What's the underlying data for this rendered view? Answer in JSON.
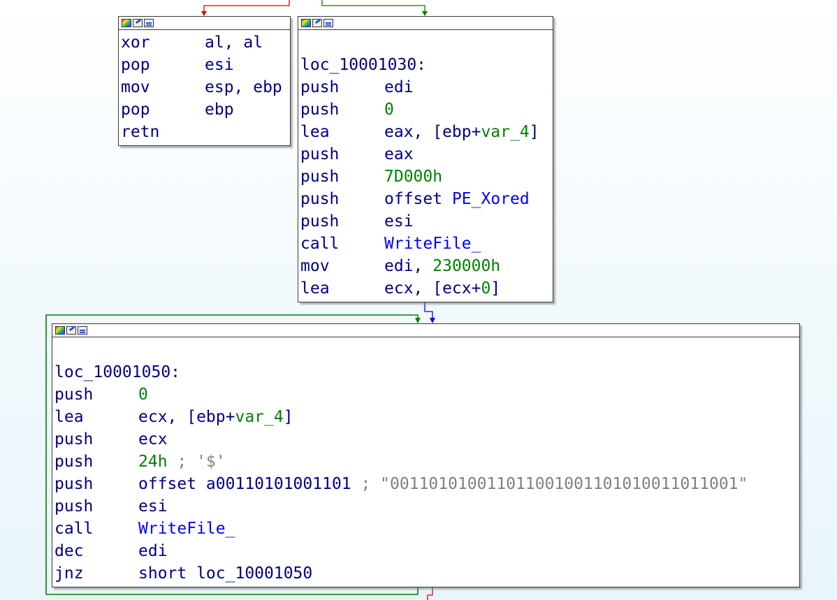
{
  "colors": {
    "mnemonic": "#000080",
    "number": "#008000",
    "function": "#0000ff",
    "comment": "#808080",
    "edge_false": "#e00000",
    "edge_true": "#008000",
    "edge_normal": "#0000ff"
  },
  "blocks": {
    "block_a": {
      "lines": [
        {
          "mn": "xor",
          "op": "al, al"
        },
        {
          "mn": "pop",
          "op": "esi"
        },
        {
          "mn": "mov",
          "op": "esp, ebp"
        },
        {
          "mn": "pop",
          "op": "ebp"
        },
        {
          "mn": "retn",
          "op": ""
        }
      ]
    },
    "block_b": {
      "label": "loc_10001030:",
      "lines": [
        {
          "mn": "push",
          "op": "edi"
        },
        {
          "mn": "push",
          "num": "0"
        },
        {
          "mn": "lea",
          "pre": "eax, [ebp+",
          "var": "var_4",
          "post": "]"
        },
        {
          "mn": "push",
          "op": "eax"
        },
        {
          "mn": "push",
          "num": "7D000h"
        },
        {
          "mn": "push",
          "op": "offset ",
          "fn": "PE_Xored"
        },
        {
          "mn": "push",
          "op": "esi"
        },
        {
          "mn": "call",
          "fn": "WriteFile_"
        },
        {
          "mn": "mov",
          "op": "edi, ",
          "num": "230000h"
        },
        {
          "mn": "lea",
          "pre": "ecx, [ecx+",
          "num": "0",
          "post": "]"
        }
      ]
    },
    "block_c": {
      "label": "loc_10001050:",
      "lines": [
        {
          "mn": "push",
          "num": "0"
        },
        {
          "mn": "lea",
          "pre": "ecx, [ebp+",
          "var": "var_4",
          "post": "]"
        },
        {
          "mn": "push",
          "op": "ecx"
        },
        {
          "mn": "push",
          "num": "24h",
          "cmt": " ; '$'"
        },
        {
          "mn": "push",
          "op": "offset a00110101001101",
          "cmt": " ; \"00110101001101100100110101001101100​1\""
        },
        {
          "mn": "push",
          "op": "esi"
        },
        {
          "mn": "call",
          "fn": "WriteFile_"
        },
        {
          "mn": "dec",
          "op": "edi"
        },
        {
          "mn": "jnz",
          "op": "short loc_10001050"
        }
      ]
    }
  }
}
